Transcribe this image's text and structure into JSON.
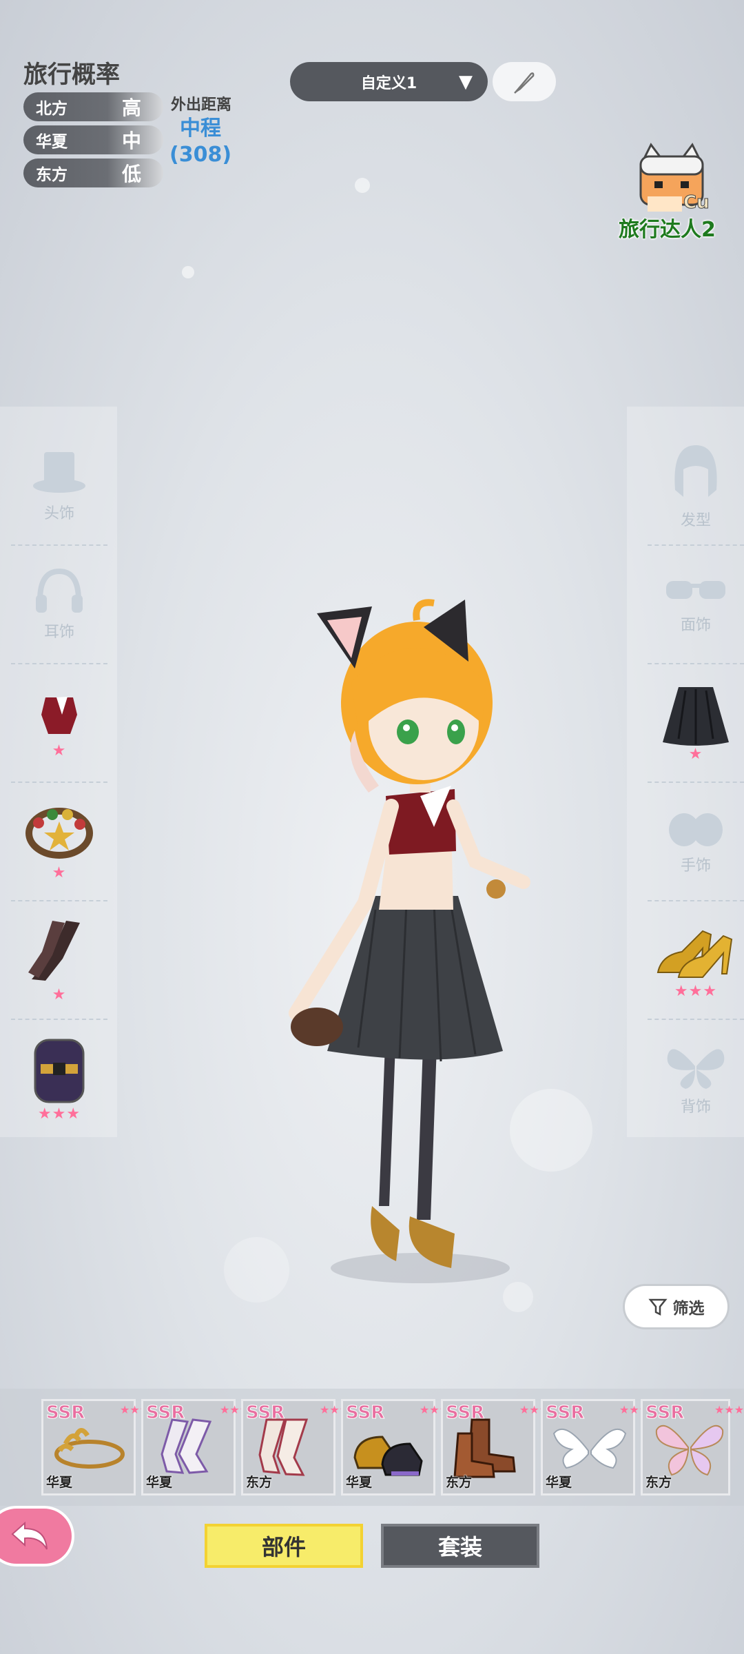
{
  "travel": {
    "title": "旅行概率",
    "rows": [
      {
        "region": "北方",
        "level": "高"
      },
      {
        "region": "华夏",
        "level": "中"
      },
      {
        "region": "东方",
        "level": "低"
      }
    ],
    "distance_label": "外出距离",
    "distance_value": "中程",
    "distance_count": "(308)"
  },
  "preset": {
    "label": "自定义1"
  },
  "badge": {
    "text": "旅行达人2",
    "tier": "Cu"
  },
  "left_slots": [
    {
      "label": "头饰",
      "icon": "hat-icon"
    },
    {
      "label": "耳饰",
      "icon": "headphones-icon"
    },
    {
      "label": "",
      "icon": "top-icon",
      "stars": "★"
    },
    {
      "label": "",
      "icon": "bracelet-icon",
      "stars": "★"
    },
    {
      "label": "",
      "icon": "stockings-icon",
      "stars": "★"
    },
    {
      "label": "",
      "icon": "choker-icon",
      "stars": "★★★"
    }
  ],
  "right_slots": [
    {
      "label": "发型",
      "icon": "hair-icon"
    },
    {
      "label": "面饰",
      "icon": "glasses-icon"
    },
    {
      "label": "",
      "icon": "skirt-icon",
      "stars": "★"
    },
    {
      "label": "手饰",
      "icon": "gloves-icon"
    },
    {
      "label": "",
      "icon": "heels-icon",
      "stars": "★★★"
    },
    {
      "label": "背饰",
      "icon": "wings-icon"
    }
  ],
  "filter": {
    "label": "筛选"
  },
  "items": [
    {
      "rarity": "SSR",
      "region": "华夏",
      "icon": "laurel-headband-icon"
    },
    {
      "rarity": "SSR",
      "region": "华夏",
      "icon": "white-stockings-icon"
    },
    {
      "rarity": "SSR",
      "region": "东方",
      "icon": "pale-stockings-icon"
    },
    {
      "rarity": "SSR",
      "region": "华夏",
      "icon": "mary-jane-shoes-icon"
    },
    {
      "rarity": "SSR",
      "region": "东方",
      "icon": "brown-boots-icon"
    },
    {
      "rarity": "SSR",
      "region": "华夏",
      "icon": "angel-wings-icon"
    },
    {
      "rarity": "SSR",
      "region": "东方",
      "icon": "fairy-wings-icon"
    }
  ],
  "item_stars": "★★★",
  "tabs": {
    "parts": "部件",
    "outfit": "套装"
  },
  "colors": {
    "accent_yellow": "#f7ec6a",
    "star_pink": "#ff6f9a",
    "distance_blue": "#3a8ed6"
  }
}
